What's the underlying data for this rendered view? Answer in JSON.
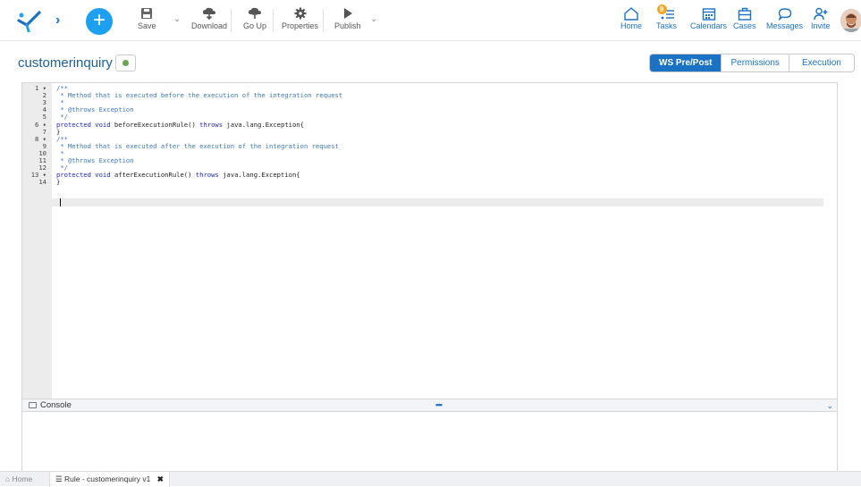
{
  "toolbar": {
    "save": "Save",
    "download": "Download",
    "go_up": "Go Up",
    "properties": "Properties",
    "publish": "Publish"
  },
  "right_nav": {
    "home": "Home",
    "tasks": "Tasks",
    "tasks_badge": "9",
    "calendars": "Calendars",
    "cases": "Cases",
    "messages": "Messages",
    "invite": "Invite"
  },
  "page": {
    "title": "customerinquiry"
  },
  "tabs": [
    "WS Pre/Post",
    "Permissions",
    "Execution"
  ],
  "editor": {
    "line_numbers": [
      "1",
      "2",
      "3",
      "4",
      "5",
      "6",
      "7",
      "8",
      "9",
      "10",
      "11",
      "12",
      "13",
      "14"
    ],
    "fold_lines": [
      "1",
      "6",
      "8",
      "13"
    ],
    "lines": [
      "/**",
      " * Method that is executed before the execution of the integration request",
      " *",
      " * @throws Exception",
      " */",
      "protected void beforeExecutionRule() throws java.lang.Exception{",
      "}",
      "/**",
      " * Method that is executed after the execution of the integration request",
      " *",
      " * @throws Exception",
      " */",
      "protected void afterExecutionRule() throws java.lang.Exception{",
      "}"
    ]
  },
  "console": {
    "title": "Console",
    "dots": "•••"
  },
  "footer": {
    "home": "Home",
    "rule_tab": "Rule - customerinquiry v1"
  },
  "colors": {
    "accent": "#1b72c5",
    "brand_plus": "#1ea0f0",
    "status_dot": "#6aa84f",
    "badge": "#f5a623"
  }
}
